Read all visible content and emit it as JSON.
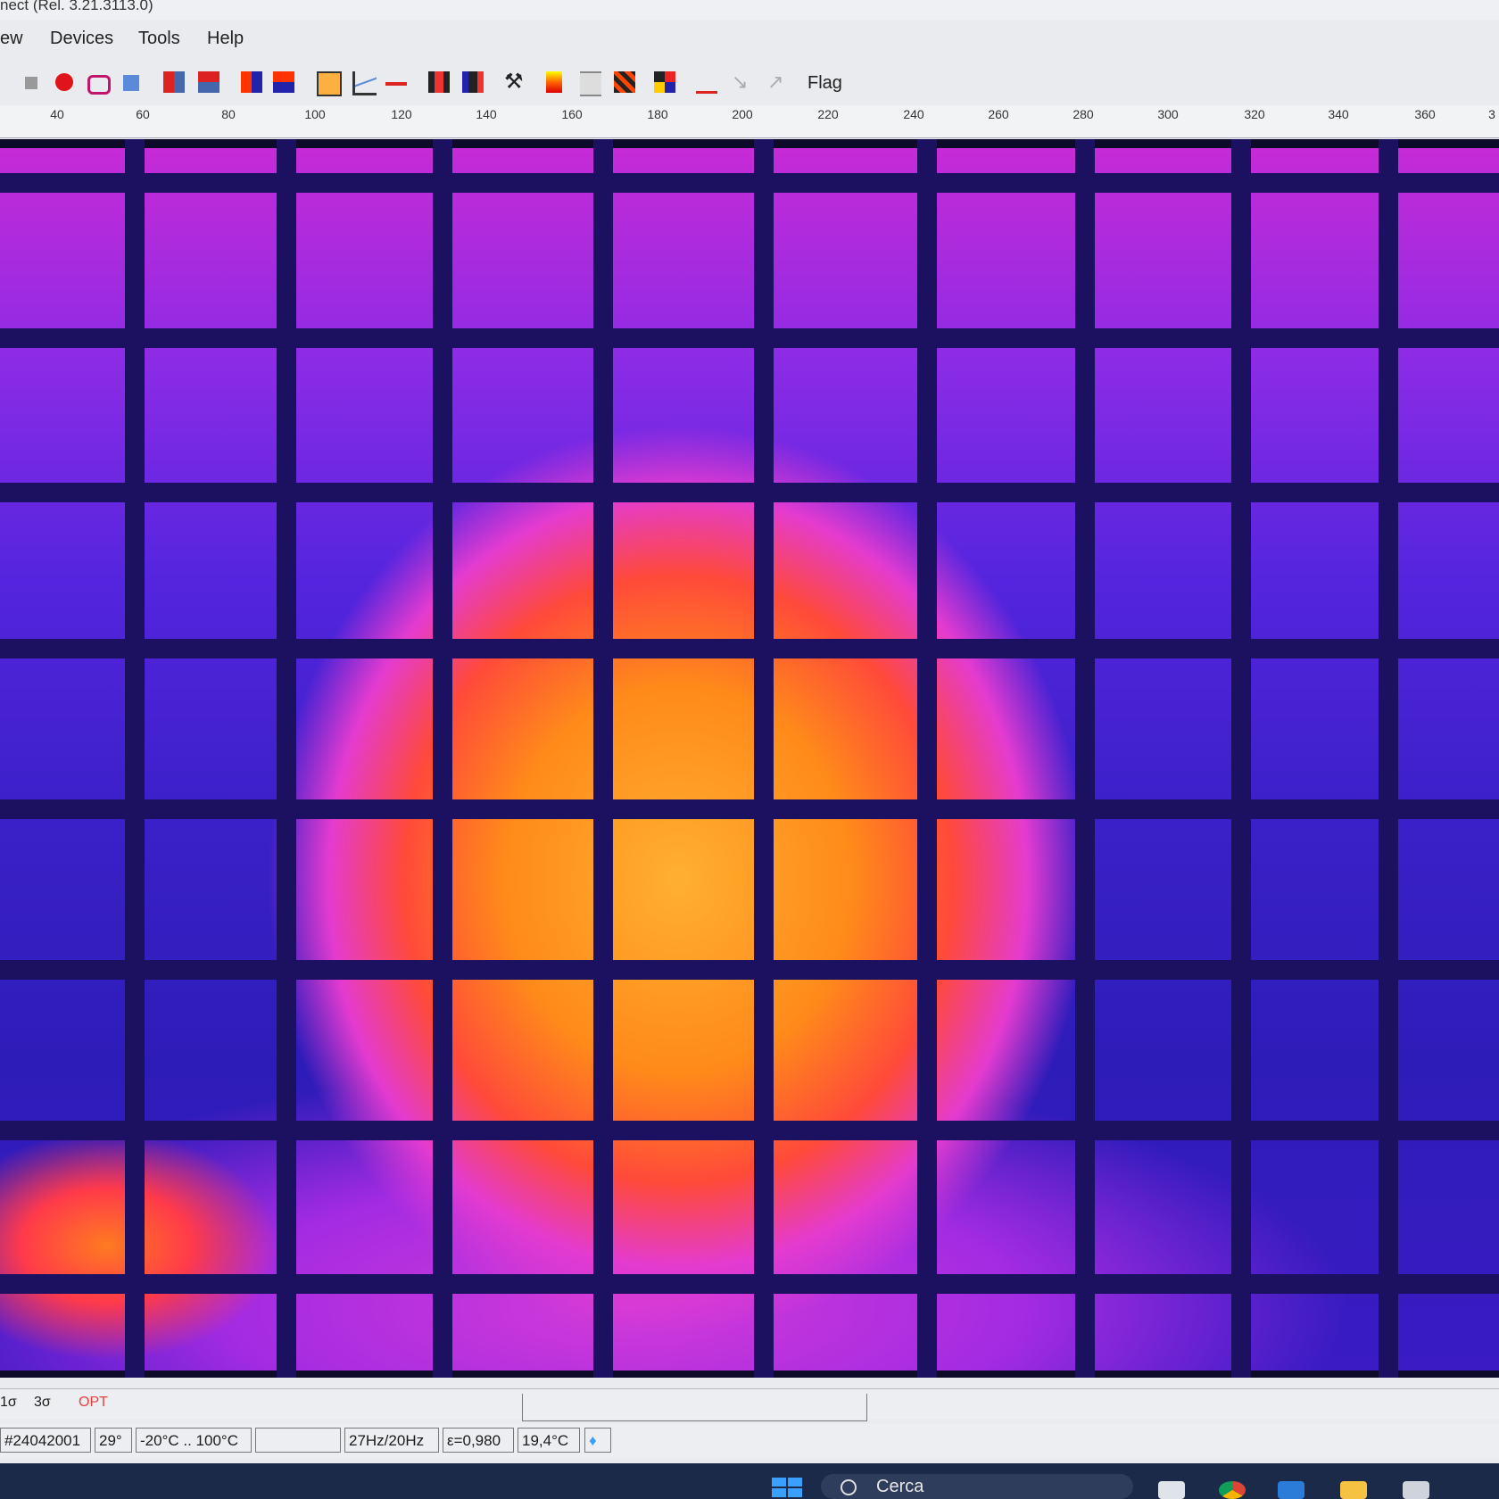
{
  "window": {
    "title": "nect (Rel. 3.21.3113.0)"
  },
  "menu": {
    "items": [
      "ew",
      "Devices",
      "Tools",
      "Help"
    ]
  },
  "toolbar": {
    "flag_label": "Flag",
    "icons": [
      "stop-icon",
      "record-icon",
      "camera-icon",
      "copy-icon",
      "layout-icon",
      "layout2-icon",
      "palette-icon",
      "palette2-icon",
      "export-icon",
      "graph-icon",
      "line-icon",
      "profile-icon",
      "histogram-icon",
      "tools-icon",
      "colorbar-icon",
      "align-icon",
      "hazard-icon",
      "grid-icon",
      "measure-icon",
      "arrow-icon",
      "arrow2-icon"
    ]
  },
  "ruler": {
    "labels": [
      "40",
      "60",
      "80",
      "100",
      "120",
      "140",
      "160",
      "180",
      "200",
      "220",
      "240",
      "260",
      "280",
      "300",
      "320",
      "340",
      "360",
      "3"
    ]
  },
  "status_row1": {
    "items": [
      "1σ",
      "3σ",
      "OPT"
    ],
    "accent_color": "#e84040"
  },
  "status_row2": {
    "serial": "#24042001",
    "fov": "29°",
    "range": "-20°C .. 100°C",
    "empty": "",
    "framerate": "27Hz/20Hz",
    "emissivity": "ε=0,980",
    "temperature": "19,4°C"
  },
  "taskbar": {
    "search_placeholder": "Cerca"
  },
  "colors": {
    "palette_hot": "#ffb030",
    "palette_cold": "#2e1cb8",
    "grid": "#1b1160"
  }
}
